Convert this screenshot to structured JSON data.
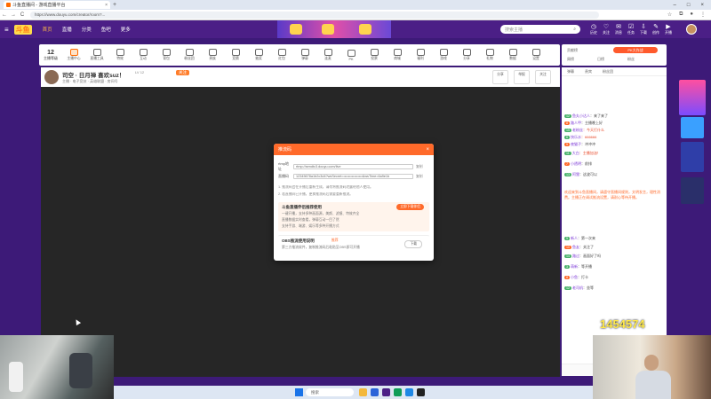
{
  "browser": {
    "tab_title": "斗鱼直播间 - 游戏直播平台",
    "url": "https://www.douyu.com/creator/room?...",
    "nav_back": "←",
    "nav_forward": "→",
    "nav_reload": "C",
    "new_tab": "+"
  },
  "site": {
    "logo": "斗鱼",
    "nav": [
      "首页",
      "直播",
      "分类",
      "鱼吧",
      "更多"
    ],
    "search_placeholder": "搜索主播",
    "header_icons": [
      {
        "icon": "history-icon",
        "label": "历史"
      },
      {
        "icon": "follow-icon",
        "label": "关注"
      },
      {
        "icon": "message-icon",
        "label": "消息"
      },
      {
        "icon": "task-icon",
        "label": "任务"
      },
      {
        "icon": "download-icon",
        "label": "下载"
      },
      {
        "icon": "creator-icon",
        "label": "创作"
      },
      {
        "icon": "stream-icon",
        "label": "开播"
      }
    ]
  },
  "room_tools": {
    "level": "12",
    "level_label": "主播等级",
    "items": [
      "主播中心",
      "直播工具",
      "特效",
      "互动",
      "背包",
      "粉丝团",
      "贵族",
      "竞猜",
      "抽奖",
      "红包",
      "弹幕",
      "连麦",
      "PK",
      "投票",
      "商城",
      "福利",
      "游戏",
      "分享",
      "礼物",
      "数据",
      "设置",
      "帮助"
    ]
  },
  "right_top": {
    "pk_label": "PK大作战",
    "tab1": "贡献榜",
    "tab2": "周榜",
    "tab3": "日榜",
    "tab4": "粉丝"
  },
  "streamer": {
    "name": "司空 · 日月禅 喜欢suz！",
    "badge": "LV 12",
    "follow": "关注",
    "sub": "主播 · 电子竞技 · 英雄联盟 · 房间号",
    "btn1": "分享",
    "btn2": "举报",
    "btn3": "关注"
  },
  "modal": {
    "title": "推流码",
    "close": "×",
    "rtmp_label": "rtmp地址",
    "rtmp_value": "rtmp://sendtc3.douyu.com/live",
    "rtmp_copy": "复制",
    "code_label": "直播码",
    "code_value": "12345678a1b2c3d4?wsSecret=••••••••••••••••&wsTime=6a9e1b",
    "code_copy": "复制",
    "note1": "1. 推流码会在开播后重新生成，请勿将推流码泄露给他人使用。",
    "note2": "2. 若直播间已开播，更换推流码后需要重新推流。",
    "promo_title": "斗鱼直播伴侣推荐使用",
    "promo_btn": "立即下载伴侣",
    "promo_line1": "一键开播，支持多种画面源，美颜、滤镜、特效齐全",
    "promo_line2": "直播数据实时查看，弹幕互动一目了然",
    "promo_line3": "支持手游、端游、娱乐等多种开播方式",
    "obs_title": "OBS推流使用说明",
    "obs_tag": "推荐",
    "obs_line": "第三方推流软件，复制推流码后粘贴至OBS即可开播",
    "obs_btn": "下载"
  },
  "chat": {
    "tab1": "弹幕",
    "tab2": "贵宾",
    "tab3": "粉丝团",
    "lines": [
      {
        "tag": "12",
        "user": "鱼丸小达人",
        "text": "：来了来了"
      },
      {
        "tag": "8",
        "user": "路人甲",
        "text": "：主播晚上好"
      },
      {
        "tag": "15",
        "user": "老粉丝",
        "text": "：今天打什么"
      },
      {
        "tag": "6",
        "user": "快乐水",
        "text": "：666666"
      },
      {
        "tag": "9",
        "user": "夜猫子",
        "text": "：冲冲冲"
      },
      {
        "tag": "11",
        "user": "大白",
        "text": "：主播加油！"
      },
      {
        "tag": "7",
        "user": "小透明",
        "text": "：前排"
      },
      {
        "tag": "13",
        "user": "阿狸",
        "text": "：这波可以"
      }
    ],
    "system_para": "欢迎来到斗鱼直播间，请遵守直播间规则，文明发言，理性消费。主播正在调试推流设置，请耐心等待开播。",
    "lines2": [
      {
        "tag": "5",
        "user": "新人",
        "text": "：第一次来"
      },
      {
        "tag": "10",
        "user": "鱼友",
        "text": "：关注了"
      },
      {
        "tag": "14",
        "user": "路过",
        "text": "：画面好了吗"
      },
      {
        "tag": "3",
        "user": "萌新",
        "text": "：等开播"
      },
      {
        "tag": "8",
        "user": "小鱼",
        "text": "：打卡"
      },
      {
        "tag": "12",
        "user": "老司机",
        "text": "：坐等"
      }
    ]
  },
  "counter": "1454574",
  "taskbar": {
    "search": "搜索"
  }
}
